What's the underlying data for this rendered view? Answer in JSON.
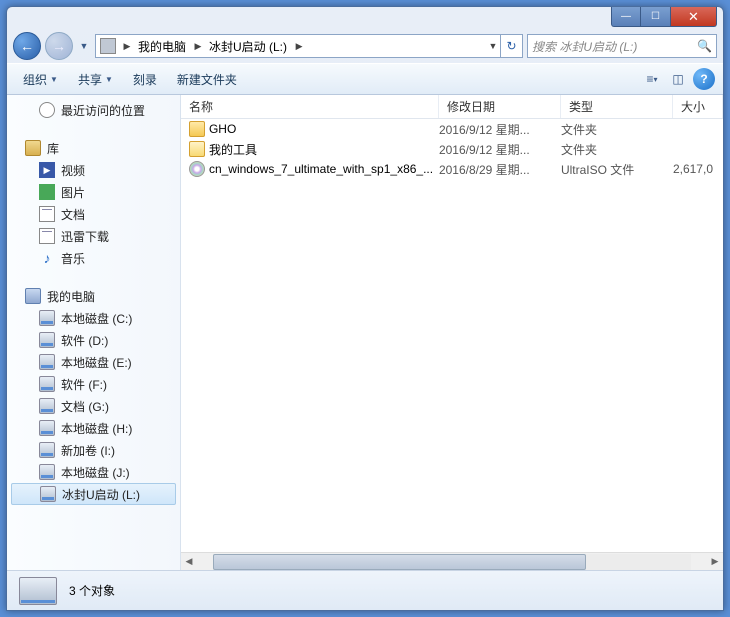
{
  "title_controls": {
    "min": "—",
    "max": "☐",
    "close": "✕"
  },
  "nav": {
    "back": "←",
    "forward": "→"
  },
  "breadcrumb": {
    "segments": [
      {
        "label": "我的电脑"
      },
      {
        "label": "冰封U启动 (L:)"
      }
    ]
  },
  "search": {
    "placeholder": "搜索 冰封U启动 (L:)"
  },
  "toolbar": {
    "organize": "组织",
    "share": "共享",
    "burn": "刻录",
    "new_folder": "新建文件夹",
    "help": "?"
  },
  "columns": {
    "name": "名称",
    "date": "修改日期",
    "type": "类型",
    "size": "大小"
  },
  "sidebar": {
    "recent": "最近访问的位置",
    "library": "库",
    "lib_items": {
      "video": "视频",
      "pictures": "图片",
      "documents": "文档",
      "xunlei": "迅雷下载",
      "music": "音乐"
    },
    "computer": "我的电脑",
    "drives": [
      "本地磁盘 (C:)",
      "软件 (D:)",
      "本地磁盘 (E:)",
      "软件 (F:)",
      "文档 (G:)",
      "本地磁盘 (H:)",
      "新加卷 (I:)",
      "本地磁盘 (J:)",
      "冰封U启动 (L:)"
    ]
  },
  "files": [
    {
      "icon": "folder",
      "name": "GHO",
      "date": "2016/9/12 星期...",
      "type": "文件夹",
      "size": ""
    },
    {
      "icon": "folder-open",
      "name": "我的工具",
      "date": "2016/9/12 星期...",
      "type": "文件夹",
      "size": ""
    },
    {
      "icon": "iso",
      "name": "cn_windows_7_ultimate_with_sp1_x86_...",
      "date": "2016/8/29 星期...",
      "type": "UltraISO 文件",
      "size": "2,617,0"
    }
  ],
  "status": {
    "count": "3 个对象"
  }
}
